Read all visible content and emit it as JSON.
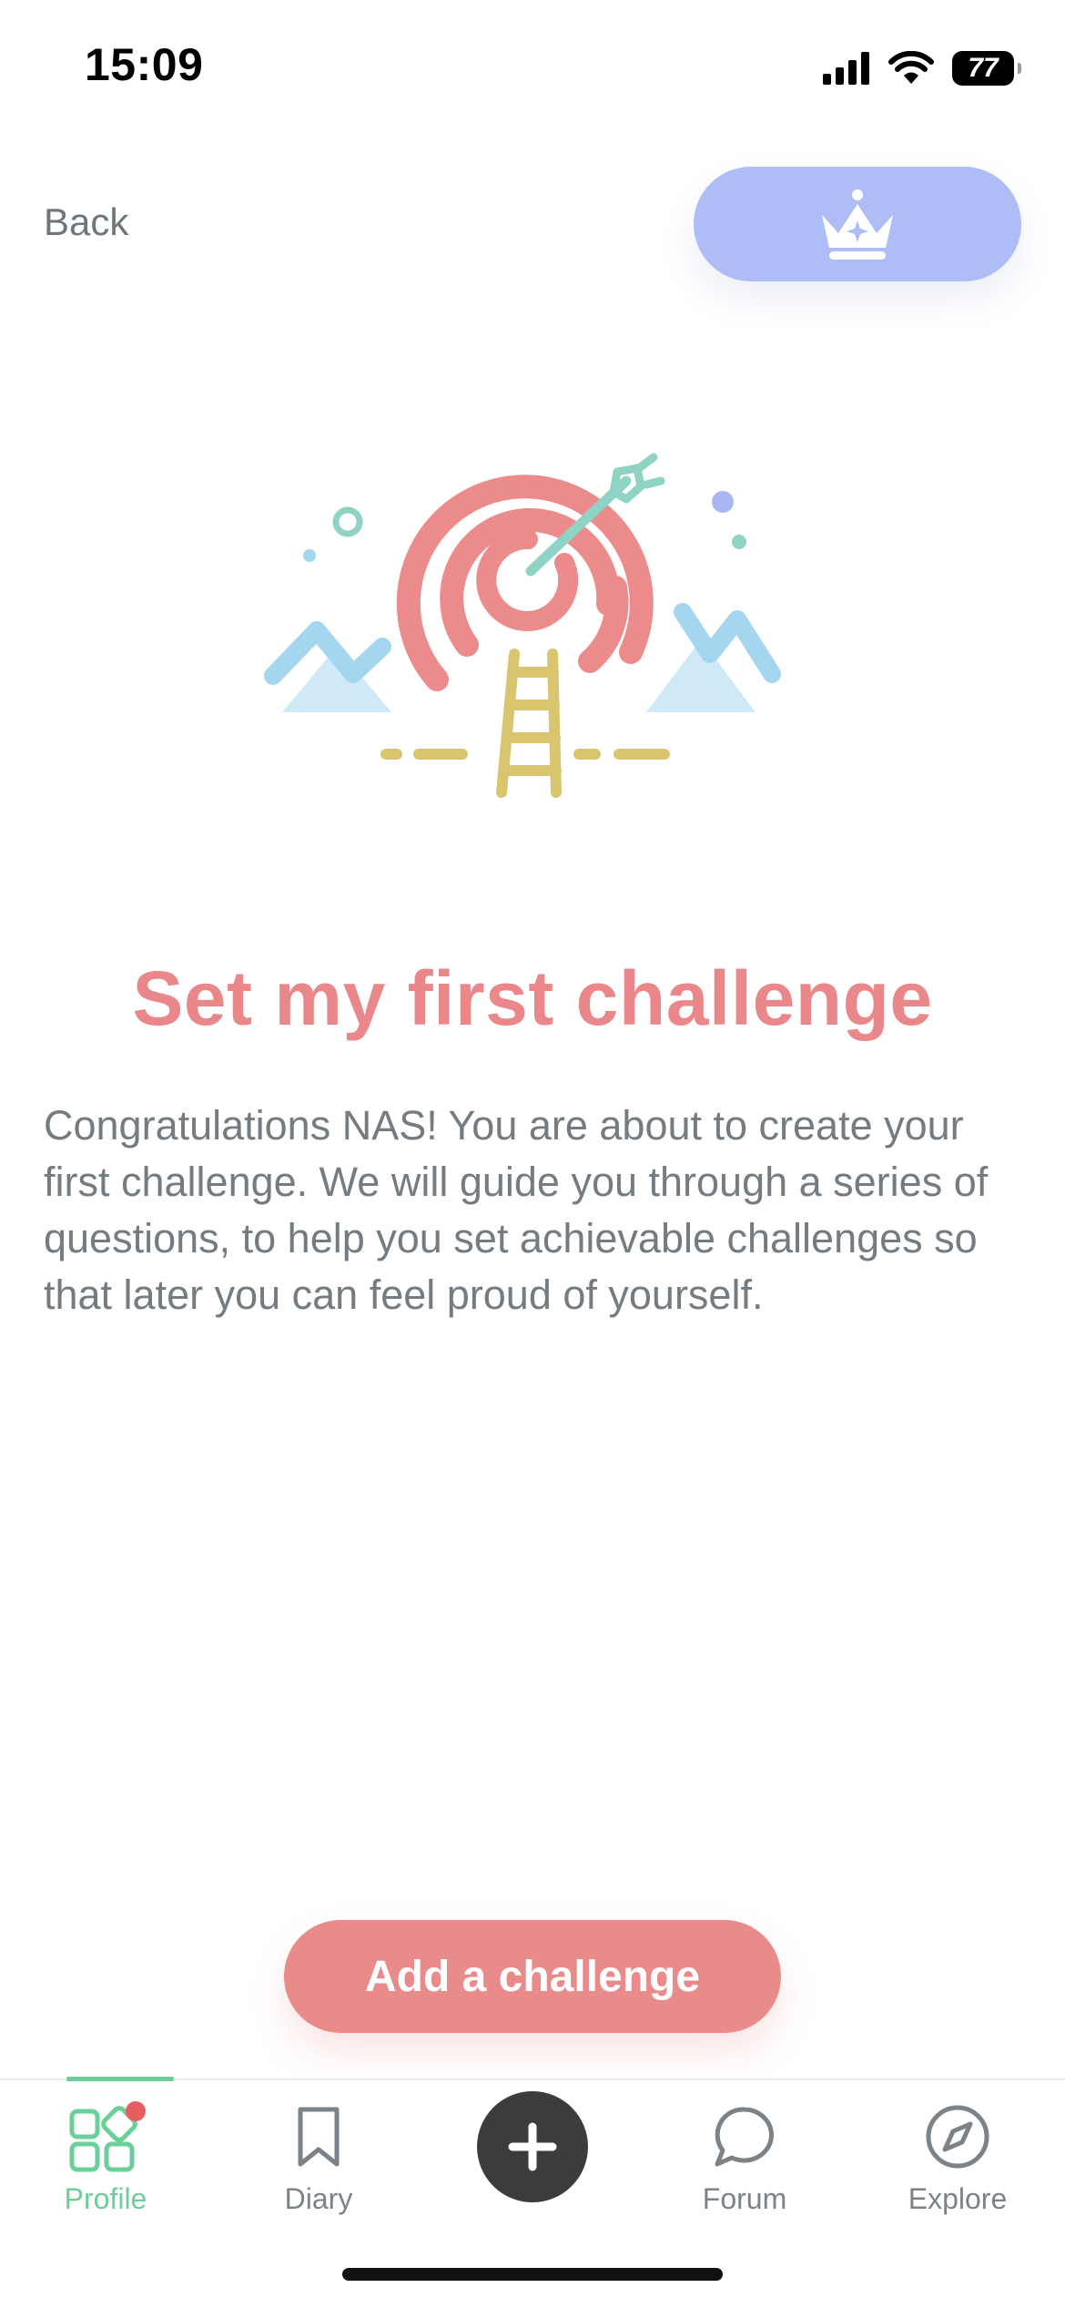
{
  "status_bar": {
    "time": "15:09",
    "battery": "77"
  },
  "header": {
    "back_label": "Back",
    "premium_icon": "crown-icon"
  },
  "main": {
    "illustration": "target-ladder-illustration",
    "title": "Set my first challenge",
    "intro": "Congratulations NAS! You are about to create your first challenge. We will guide you through a series of questions, to help you set achievable challenges so that later you can feel proud of yourself.",
    "cta_label": "Add a challenge"
  },
  "tab_bar": {
    "tabs": [
      {
        "label": "Profile",
        "icon": "grid-icon",
        "active": true,
        "badge": true
      },
      {
        "label": "Diary",
        "icon": "bookmark-icon"
      },
      {
        "label": "Forum",
        "icon": "chat-bubble-icon"
      },
      {
        "label": "Explore",
        "icon": "compass-icon"
      }
    ],
    "add_icon": "plus-icon"
  },
  "colors": {
    "accent_coral": "#e98a8b",
    "premium_blue": "#aebdf5",
    "active_green": "#6bcf9a",
    "text_gray": "#757c81"
  }
}
